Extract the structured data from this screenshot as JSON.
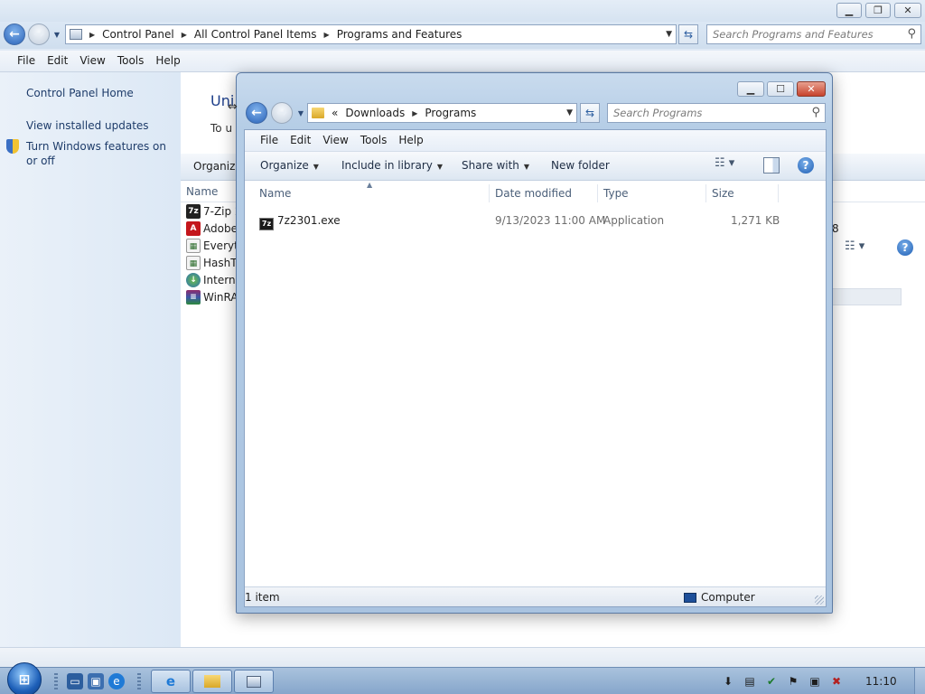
{
  "background_window": {
    "breadcrumb": [
      "Control Panel",
      "All Control Panel Items",
      "Programs and Features"
    ],
    "search_placeholder": "Search Programs and Features",
    "menu": [
      "File",
      "Edit",
      "View",
      "Tools",
      "Help"
    ],
    "tasks": [
      "Control Panel Home",
      "View installed updates",
      "Turn Windows features on or off"
    ],
    "heading": "Uni",
    "subtext": "To u",
    "toolbar_organize": "Organize",
    "column_name": "Name",
    "programs": [
      "7-Zip 2",
      "Adobe",
      "Everyth",
      "HashT",
      "Interne",
      "WinRA"
    ],
    "right_digit": "8"
  },
  "explorer_window": {
    "breadcrumb_prefix": "«",
    "breadcrumb": [
      "Downloads",
      "Programs"
    ],
    "search_placeholder": "Search Programs",
    "menu": [
      "File",
      "Edit",
      "View",
      "Tools",
      "Help"
    ],
    "toolbar": {
      "organize": "Organize",
      "include_in_library": "Include in library",
      "share_with": "Share with",
      "new_folder": "New folder"
    },
    "columns": [
      "Name",
      "Date modified",
      "Type",
      "Size"
    ],
    "files": [
      {
        "name": "7z2301.exe",
        "date_modified": "9/13/2023 11:00 AM",
        "type": "Application",
        "size": "1,271 KB"
      }
    ],
    "status_count": "1 item",
    "status_location": "Computer"
  },
  "taskbar": {
    "clock": "11:10"
  }
}
